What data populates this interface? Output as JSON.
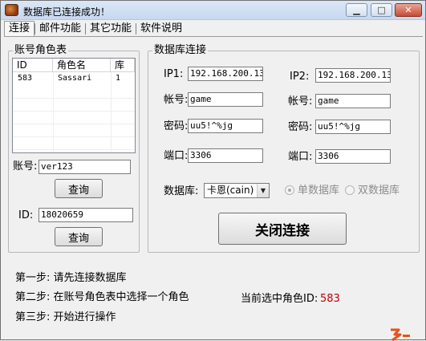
{
  "window": {
    "title": "数据库已连接成功！",
    "minimize": "▁",
    "maximize": "□",
    "close": "✕"
  },
  "tabs": [
    "连接",
    "邮件功能",
    "其它功能",
    "软件说明"
  ],
  "account_group": {
    "title": "账号角色表",
    "columns": [
      "ID",
      "角色名",
      "库"
    ],
    "rows": [
      {
        "id": "583",
        "name": "Sassari",
        "db": "1"
      }
    ],
    "account_label": "账号:",
    "account_value": "ver123",
    "query_button": "查询",
    "id_label": "ID:",
    "id_value": "18020659",
    "query_button2": "查询"
  },
  "db_group": {
    "title": "数据库连接",
    "ip1_label": "IP1:",
    "ip1_value": "192.168.200.131",
    "ip2_label": "IP2:",
    "ip2_value": "192.168.200.131",
    "account1_label": "帐号:",
    "account1_value": "game",
    "account2_label": "帐号:",
    "account2_value": "game",
    "password1_label": "密码:",
    "password1_value": "uu5!^%jg",
    "password2_label": "密码:",
    "password2_value": "uu5!^%jg",
    "port1_label": "端口:",
    "port1_value": "3306",
    "port2_label": "端口:",
    "port2_value": "3306",
    "database_label": "数据库:",
    "database_selected": "卡恩(cain)",
    "radio_single": "单数据库",
    "radio_double": "双数据库",
    "close_button": "关闭连接"
  },
  "steps": {
    "step1": "第一步: 请先连接数据库",
    "step2": "第二步: 在账号角色表中选择一个角色",
    "step3": "第三步: 开始进行操作",
    "selected_label": "当前选中角色ID:",
    "selected_value": "583"
  },
  "colors": {
    "selected_value": "#c00000",
    "watermark": "#e8501c"
  }
}
